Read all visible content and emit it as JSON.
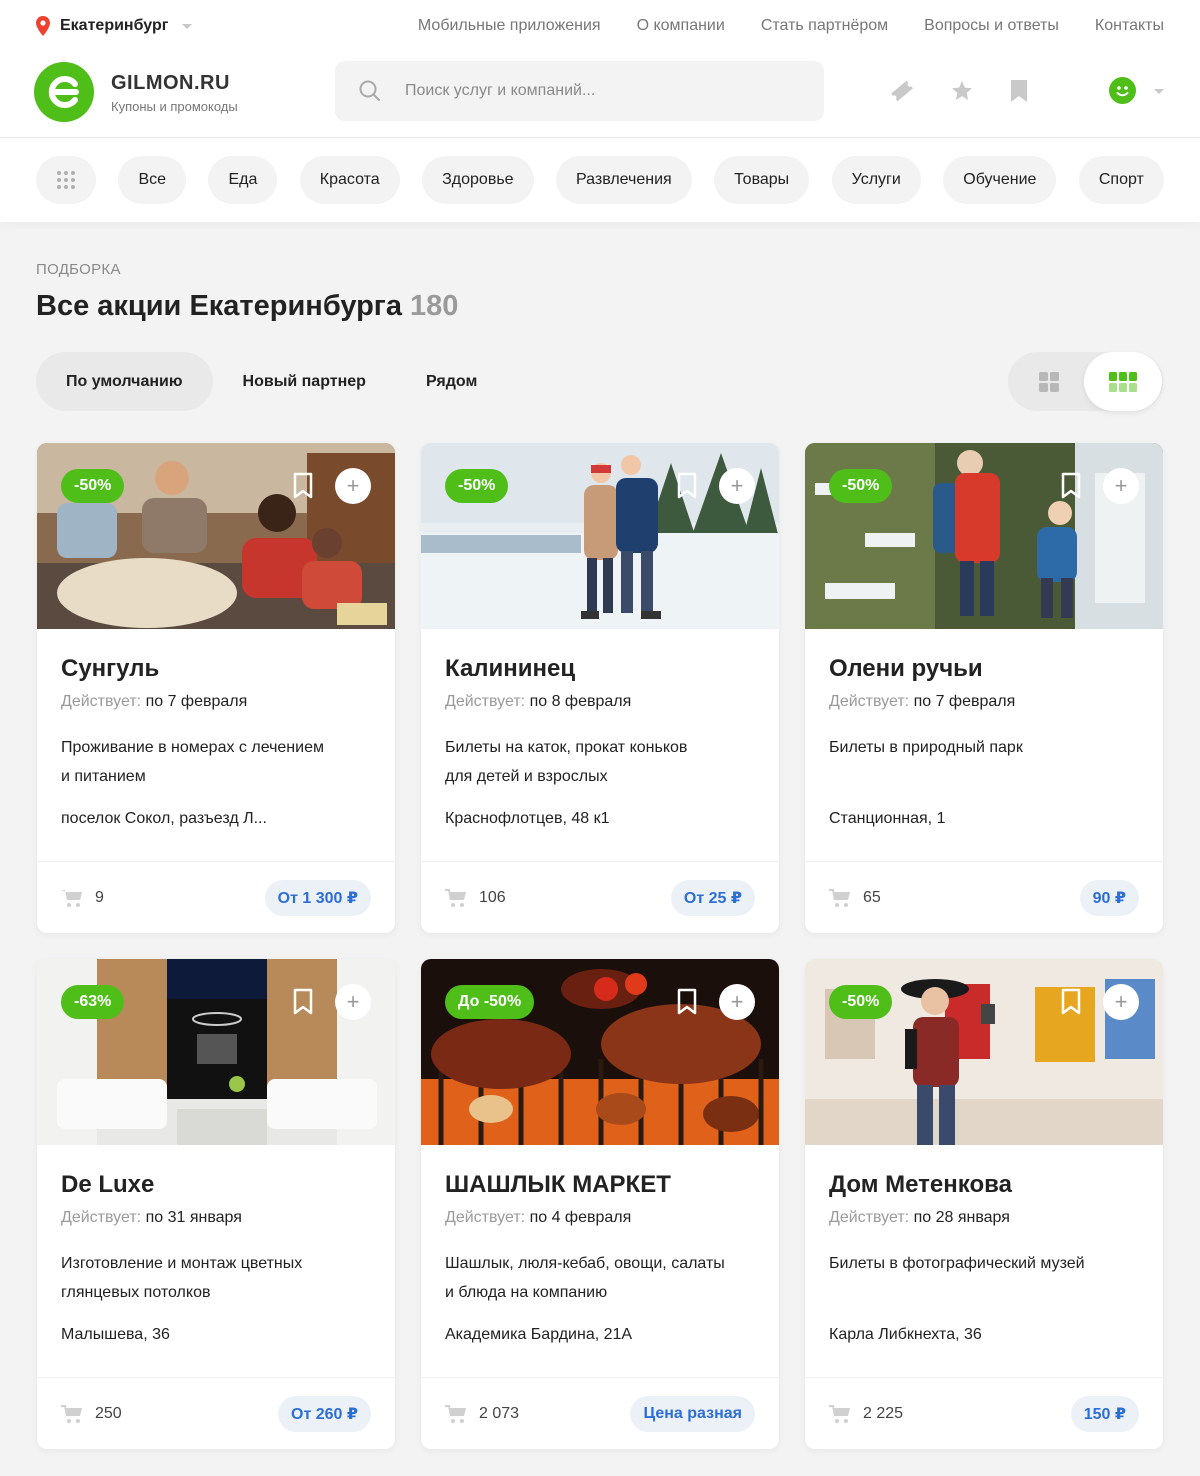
{
  "topbar": {
    "city": "Екатеринбург",
    "nav": [
      "Мобильные приложения",
      "О компании",
      "Стать партнёром",
      "Вопросы и ответы",
      "Контакты"
    ]
  },
  "header": {
    "brand_name": "GILMON.RU",
    "brand_tagline": "Купоны и промокоды",
    "search_placeholder": "Поиск услуг и компаний..."
  },
  "categories": [
    "Все",
    "Еда",
    "Красота",
    "Здоровье",
    "Развлечения",
    "Товары",
    "Услуги",
    "Обучение",
    "Спорт"
  ],
  "section": {
    "eyebrow": "ПОДБОРКА",
    "title": "Все акции Екатеринбурга",
    "count": "180"
  },
  "sorts": [
    "По умолчанию",
    "Новый партнер",
    "Рядом"
  ],
  "valid_label": "Действует:",
  "colors": {
    "accent": "#4fbe19",
    "price_text": "#2a6ed6",
    "price_bg": "#ecf1f8"
  },
  "cards": [
    {
      "discount": "-50%",
      "title": "Сунгуль",
      "valid_until": "по 7 февраля",
      "desc_1": "Проживание в номерах с лечением",
      "desc_2": "и питанием",
      "address": "поселок Сокол, разъезд Л...",
      "sold": "9",
      "price": "От 1 300 ₽"
    },
    {
      "discount": "-50%",
      "title": "Калининец",
      "valid_until": "по 8 февраля",
      "desc_1": "Билеты на каток, прокат коньков",
      "desc_2": "для детей и взрослых",
      "address": "Краснофлотцев, 48 к1",
      "sold": "106",
      "price": "От 25 ₽"
    },
    {
      "discount": "-50%",
      "title": "Олени ручьи",
      "valid_until": "по 7 февраля",
      "desc_1": "Билеты в природный парк",
      "desc_2": "",
      "address": "Станционная, 1",
      "sold": "65",
      "price": "90 ₽"
    },
    {
      "discount": "-63%",
      "title": "De Luxe",
      "valid_until": "по 31 января",
      "desc_1": "Изготовление и монтаж цветных",
      "desc_2": "глянцевых потолков",
      "address": "Малышева, 36",
      "sold": "250",
      "price": "От 260 ₽"
    },
    {
      "discount": "До -50%",
      "title": "ШАШЛЫК МАРКЕТ",
      "valid_until": "по 4 февраля",
      "desc_1": "Шашлык, люля-кебаб, овощи, салаты",
      "desc_2": "и блюда на компанию",
      "address": "Академика Бардина, 21А",
      "sold": "2 073",
      "price": "Цена разная"
    },
    {
      "discount": "-50%",
      "title": "Дом Метенкова",
      "valid_until": "по 28 января",
      "desc_1": "Билеты в фотографический музей",
      "desc_2": "",
      "address": "Карла Либкнехта, 36",
      "sold": "2 225",
      "price": "150 ₽"
    }
  ]
}
